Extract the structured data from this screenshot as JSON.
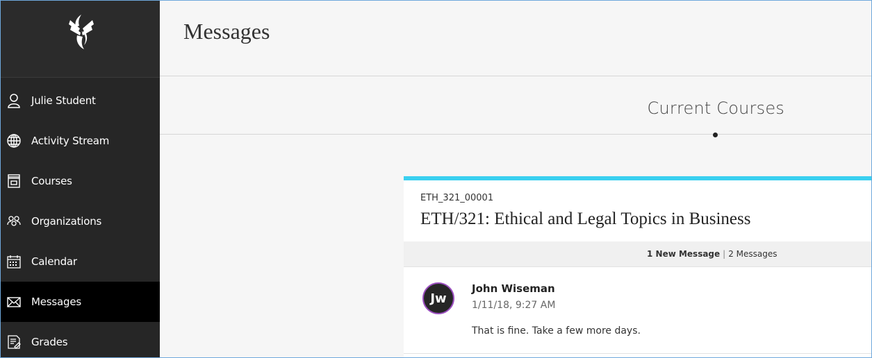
{
  "sidebar": {
    "items": [
      {
        "label": "Julie Student",
        "icon": "user-icon"
      },
      {
        "label": "Activity Stream",
        "icon": "globe-icon"
      },
      {
        "label": "Courses",
        "icon": "courses-icon"
      },
      {
        "label": "Organizations",
        "icon": "organizations-icon"
      },
      {
        "label": "Calendar",
        "icon": "calendar-icon"
      },
      {
        "label": "Messages",
        "icon": "envelope-icon"
      },
      {
        "label": "Grades",
        "icon": "grades-icon"
      }
    ],
    "active": "Messages"
  },
  "header": {
    "title": "Messages"
  },
  "filter": {
    "label": "Current Courses"
  },
  "course": {
    "code": "ETH_321_00001",
    "title": "ETH/321: Ethical and Legal Topics in Business",
    "new_count": "1 New Message",
    "separator": "|",
    "total_count": "2 Messages",
    "messages": [
      {
        "avatar_initials": "Jw",
        "sender": "John Wiseman",
        "date": "1/11/18, 9:27 AM",
        "body": "That is fine. Take a few more days."
      }
    ]
  },
  "colors": {
    "sidebar_bg": "#262626",
    "active_bg": "#000000",
    "accent": "#3ad0f0",
    "avatar_ring": "#9b4fbf"
  }
}
